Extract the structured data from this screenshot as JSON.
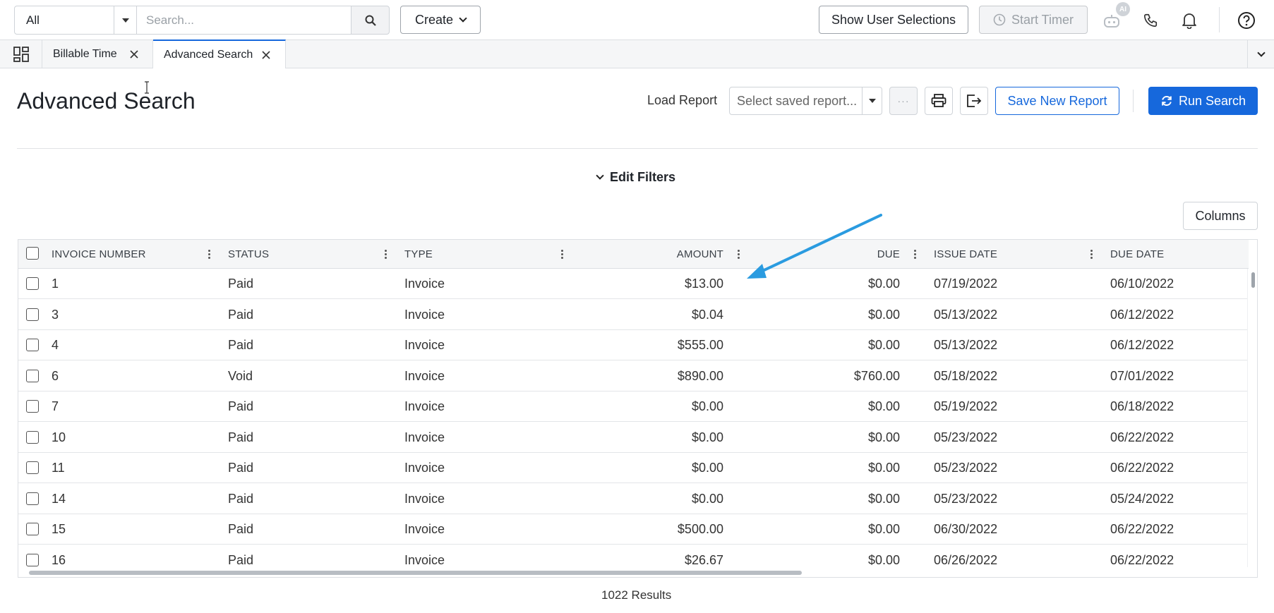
{
  "topbar": {
    "scope_value": "All",
    "search_placeholder": "Search...",
    "create_label": "Create",
    "show_user_selections_label": "Show User Selections",
    "start_timer_label": "Start Timer",
    "ai_badge": "AI"
  },
  "tabs": [
    {
      "label": "Billable Time",
      "active": false
    },
    {
      "label": "Advanced Search",
      "active": true
    }
  ],
  "header": {
    "title": "Advanced Search",
    "load_report_label": "Load Report",
    "report_placeholder": "Select saved report...",
    "more_label": "···",
    "save_new_report_label": "Save New Report",
    "run_search_label": "Run Search"
  },
  "filters": {
    "edit_filters_label": "Edit Filters"
  },
  "columns_button_label": "Columns",
  "table": {
    "columns": [
      "INVOICE NUMBER",
      "STATUS",
      "TYPE",
      "AMOUNT",
      "DUE",
      "ISSUE DATE",
      "DUE DATE"
    ],
    "rows": [
      [
        "1",
        "Paid",
        "Invoice",
        "$13.00",
        "$0.00",
        "07/19/2022",
        "06/10/2022"
      ],
      [
        "3",
        "Paid",
        "Invoice",
        "$0.04",
        "$0.00",
        "05/13/2022",
        "06/12/2022"
      ],
      [
        "4",
        "Paid",
        "Invoice",
        "$555.00",
        "$0.00",
        "05/13/2022",
        "06/12/2022"
      ],
      [
        "6",
        "Void",
        "Invoice",
        "$890.00",
        "$760.00",
        "05/18/2022",
        "07/01/2022"
      ],
      [
        "7",
        "Paid",
        "Invoice",
        "$0.00",
        "$0.00",
        "05/19/2022",
        "06/18/2022"
      ],
      [
        "10",
        "Paid",
        "Invoice",
        "$0.00",
        "$0.00",
        "05/23/2022",
        "06/22/2022"
      ],
      [
        "11",
        "Paid",
        "Invoice",
        "$0.00",
        "$0.00",
        "05/23/2022",
        "06/22/2022"
      ],
      [
        "14",
        "Paid",
        "Invoice",
        "$0.00",
        "$0.00",
        "05/23/2022",
        "05/24/2022"
      ],
      [
        "15",
        "Paid",
        "Invoice",
        "$500.00",
        "$0.00",
        "06/30/2022",
        "06/22/2022"
      ],
      [
        "16",
        "Paid",
        "Invoice",
        "$26.67",
        "$0.00",
        "06/26/2022",
        "06/22/2022"
      ]
    ]
  },
  "results_text": "1022 Results",
  "colors": {
    "accent": "#1668dc",
    "annotation_arrow": "#2a9be0"
  }
}
